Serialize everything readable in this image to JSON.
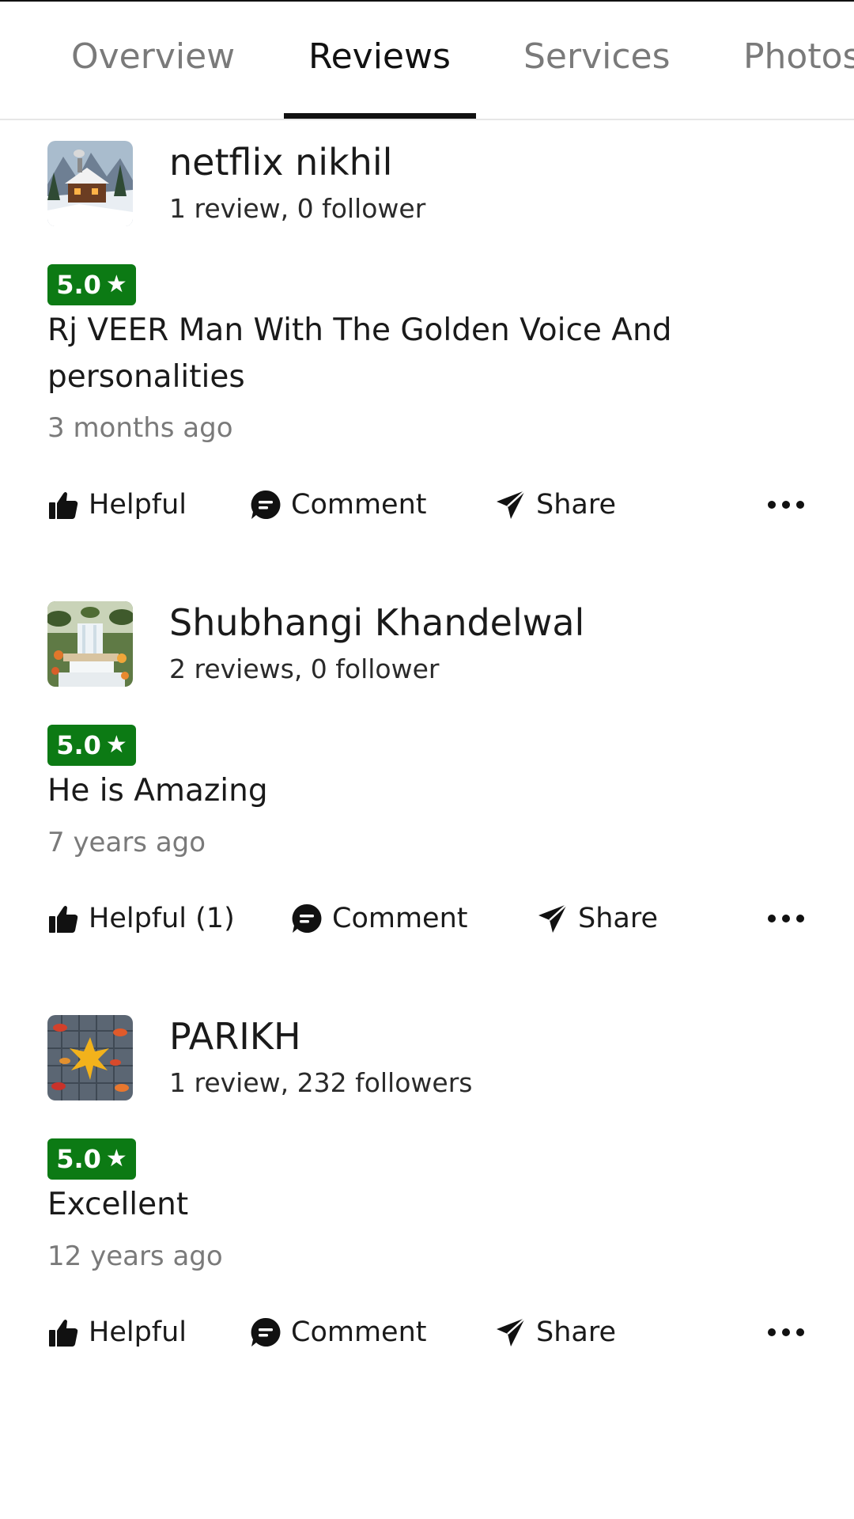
{
  "tabs": [
    {
      "label": "Overview",
      "active": false
    },
    {
      "label": "Reviews",
      "active": true
    },
    {
      "label": "Services",
      "active": false
    },
    {
      "label": "Photos",
      "active": false
    }
  ],
  "reviews": [
    {
      "name": "netflix nikhil",
      "meta": "1 review, 0 follower",
      "rating": "5.0",
      "text": "Rj VEER Man With The Golden Voice And personalities",
      "date": "3 months ago",
      "helpful_label": "Helpful",
      "comment_label": "Comment",
      "share_label": "Share",
      "avatar_icon": "cabin-snow-photo"
    },
    {
      "name": "Shubhangi Khandelwal",
      "meta": "2 reviews, 0 follower",
      "rating": "5.0",
      "text": "He is Amazing",
      "date": "7 years ago",
      "helpful_label": "Helpful (1)",
      "comment_label": "Comment",
      "share_label": "Share",
      "avatar_icon": "waterfall-photo"
    },
    {
      "name": "PARIKH",
      "meta": "1 review, 232 followers",
      "rating": "5.0",
      "text": "Excellent",
      "date": "12 years ago",
      "helpful_label": "Helpful",
      "comment_label": "Comment",
      "share_label": "Share",
      "avatar_icon": "autumn-leaves-photo"
    }
  ],
  "colors": {
    "rating_badge": "#0c7a14",
    "tab_active": "#111111",
    "tab_inactive": "#7a7a7a",
    "muted_text": "#7a7a7a"
  },
  "icons": {
    "rating": "star-icon",
    "helpful": "thumbs-up-icon",
    "comment": "comment-bubble-icon",
    "share": "send-arrow-icon",
    "more": "more-horizontal-icon"
  }
}
